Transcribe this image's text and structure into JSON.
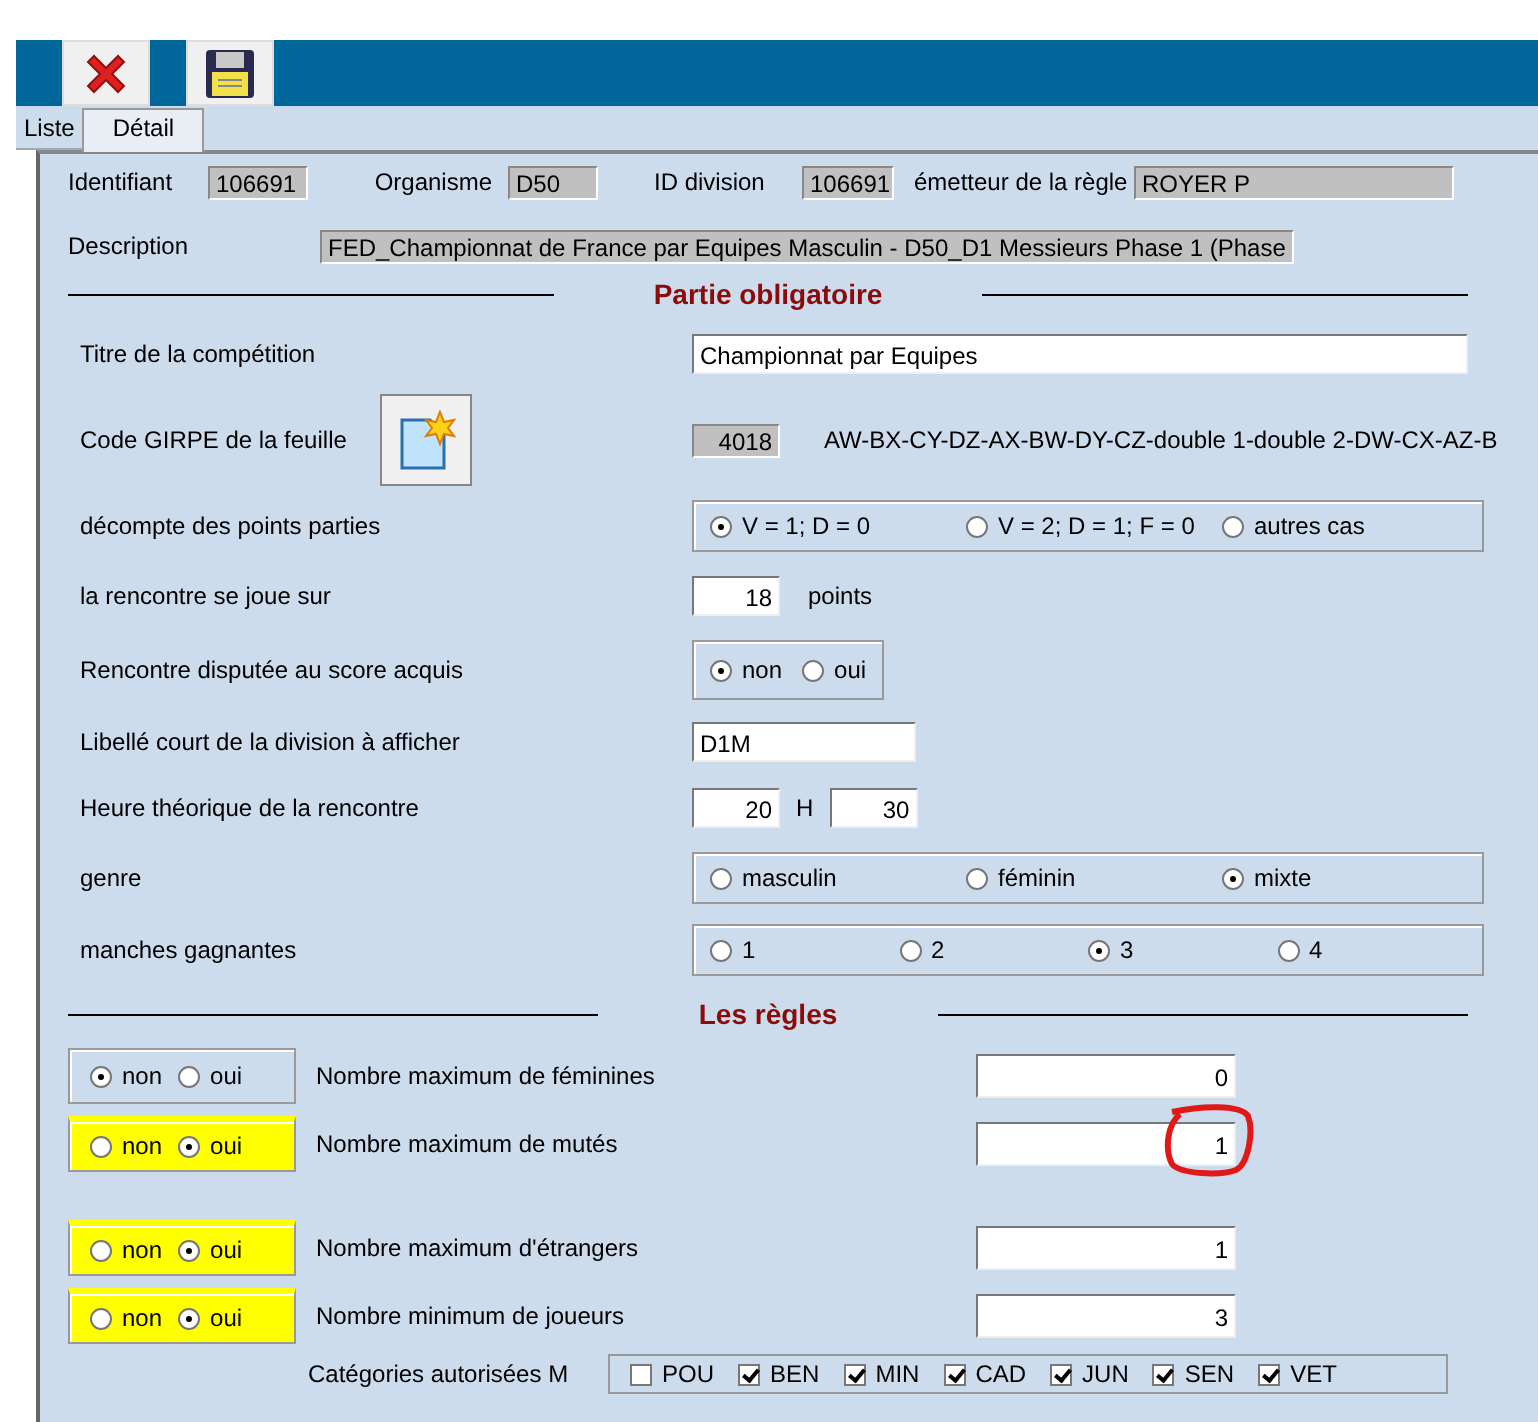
{
  "tabs": [
    {
      "label": "Liste",
      "selected": false
    },
    {
      "label": "Détail",
      "selected": true
    }
  ],
  "header_fields": [
    {
      "label": "Identifiant",
      "value": "106691"
    },
    {
      "label": "Organisme",
      "value": "D50"
    },
    {
      "label": "ID division",
      "value": "106691"
    },
    {
      "label": "émetteur de la règle",
      "value": "ROYER P"
    }
  ],
  "description": {
    "label": "Description",
    "value": "FED_Championnat de France par Equipes Masculin - D50_D1 Messieurs Phase 1 (Phase"
  },
  "partie_obligatoire": {
    "title": "Partie obligatoire",
    "rows": [
      {
        "kind": "text",
        "label": "Titre de la compétition",
        "value": "Championnat par Equipes"
      },
      {
        "kind": "girpe",
        "label": "Code GIRPE de la feuille",
        "value": "4018",
        "code": "AW-BX-CY-DZ-AX-BW-DY-CZ-double 1-double 2-DW-CX-AZ-B"
      },
      {
        "kind": "radio",
        "label": "décompte des points parties",
        "options": [
          {
            "label": "V = 1; D = 0",
            "selected": true
          },
          {
            "label": "V = 2; D = 1; F = 0",
            "selected": false
          },
          {
            "label": "autres cas",
            "selected": false
          }
        ]
      },
      {
        "kind": "number",
        "label": "la rencontre se joue sur",
        "value": "18",
        "unit": "points"
      },
      {
        "kind": "radio-small",
        "label": "Rencontre disputée au score acquis",
        "options": [
          {
            "label": "non",
            "selected": true
          },
          {
            "label": "oui",
            "selected": false
          }
        ]
      },
      {
        "kind": "short",
        "label": "Libellé court de la division à afficher",
        "value": "D1M"
      },
      {
        "kind": "time",
        "label": "Heure théorique de la rencontre",
        "hours": "20",
        "unit": "H",
        "minutes": "30"
      },
      {
        "kind": "radio",
        "label": "genre",
        "options": [
          {
            "label": "masculin",
            "selected": false
          },
          {
            "label": "féminin",
            "selected": false
          },
          {
            "label": "mixte",
            "selected": true
          }
        ]
      },
      {
        "kind": "radio",
        "label": "manches gagnantes",
        "options": [
          {
            "label": "1",
            "selected": false
          },
          {
            "label": "2",
            "selected": false
          },
          {
            "label": "3",
            "selected": true
          },
          {
            "label": "4",
            "selected": false
          }
        ]
      }
    ]
  },
  "regles": {
    "title": "Les règles",
    "groups": [
      [
        {
          "highlighted": false,
          "options": [
            {
              "label": "non",
              "selected": true
            },
            {
              "label": "oui",
              "selected": false
            }
          ],
          "label": "Nombre maximum de féminines",
          "value": "0",
          "circled": false
        },
        {
          "highlighted": true,
          "options": [
            {
              "label": "non",
              "selected": false
            },
            {
              "label": "oui",
              "selected": true
            }
          ],
          "label": "Nombre maximum de mutés",
          "value": "1",
          "circled": true
        }
      ],
      [
        {
          "highlighted": true,
          "options": [
            {
              "label": "non",
              "selected": false
            },
            {
              "label": "oui",
              "selected": true
            }
          ],
          "label": "Nombre maximum d'étrangers",
          "value": "1",
          "circled": false
        },
        {
          "highlighted": true,
          "options": [
            {
              "label": "non",
              "selected": false
            },
            {
              "label": "oui",
              "selected": true
            }
          ],
          "label": "Nombre minimum de joueurs",
          "value": "3",
          "circled": false
        }
      ]
    ],
    "categories": {
      "label": "Catégories autorisées M",
      "items": [
        {
          "label": "POU",
          "checked": false
        },
        {
          "label": "BEN",
          "checked": true
        },
        {
          "label": "MIN",
          "checked": true
        },
        {
          "label": "CAD",
          "checked": true
        },
        {
          "label": "JUN",
          "checked": true
        },
        {
          "label": "SEN",
          "checked": true
        },
        {
          "label": "VET",
          "checked": true
        }
      ]
    }
  }
}
